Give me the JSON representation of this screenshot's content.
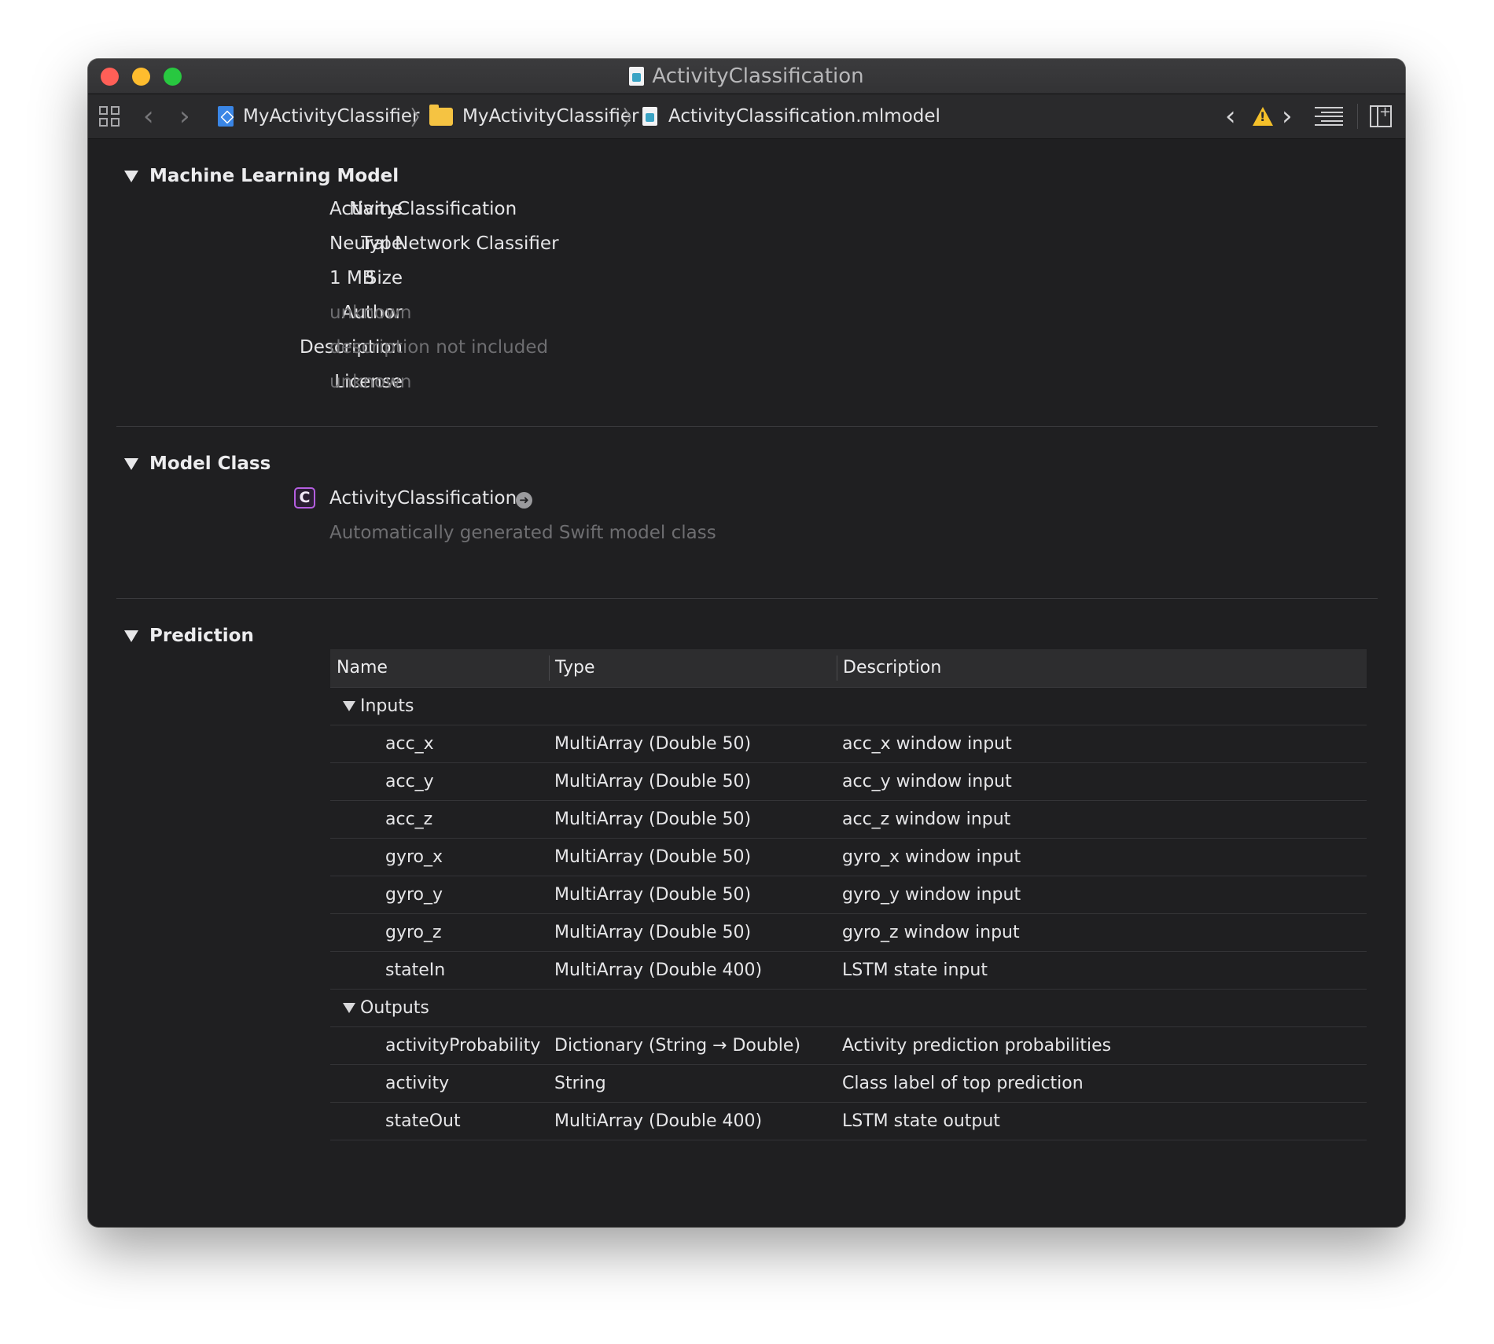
{
  "window": {
    "title": "ActivityClassification",
    "colors": {
      "close": "#ff5f57",
      "minimize": "#febc2e",
      "zoom": "#28c840",
      "background": "#1f1f21",
      "class_badge": "#b45ee0",
      "warning": "#f4c02a"
    }
  },
  "jumpbar": {
    "crumbs": [
      {
        "label": "MyActivityClassifier",
        "icon": "xcode-project-icon"
      },
      {
        "label": "MyActivityClassifier",
        "icon": "folder-icon"
      },
      {
        "label": "ActivityClassification.mlmodel",
        "icon": "mlmodel-file-icon"
      }
    ]
  },
  "model": {
    "section_title": "Machine Learning Model",
    "fields": [
      {
        "label": "Name",
        "value": "ActivityClassification"
      },
      {
        "label": "Type",
        "value": "Neural Network Classifier"
      },
      {
        "label": "Size",
        "value": "1 MB"
      },
      {
        "label": "Author",
        "value": "unknown"
      },
      {
        "label": "Description",
        "value": "description not included"
      },
      {
        "label": "License",
        "value": "unknown"
      }
    ]
  },
  "model_class": {
    "section_title": "Model Class",
    "badge": "C",
    "name": "ActivityClassification",
    "subtitle": "Automatically generated Swift model class"
  },
  "prediction": {
    "section_title": "Prediction",
    "columns": [
      "Name",
      "Type",
      "Description"
    ],
    "inputs_label": "Inputs",
    "inputs": [
      {
        "name": "acc_x",
        "type": "MultiArray (Double 50)",
        "description": "acc_x window input"
      },
      {
        "name": "acc_y",
        "type": "MultiArray (Double 50)",
        "description": "acc_y window input"
      },
      {
        "name": "acc_z",
        "type": "MultiArray (Double 50)",
        "description": "acc_z window input"
      },
      {
        "name": "gyro_x",
        "type": "MultiArray (Double 50)",
        "description": "gyro_x window input"
      },
      {
        "name": "gyro_y",
        "type": "MultiArray (Double 50)",
        "description": "gyro_y window input"
      },
      {
        "name": "gyro_z",
        "type": "MultiArray (Double 50)",
        "description": "gyro_z window input"
      },
      {
        "name": "stateIn",
        "type": "MultiArray (Double 400)",
        "description": "LSTM state input"
      }
    ],
    "outputs_label": "Outputs",
    "outputs": [
      {
        "name": "activityProbability",
        "type": "Dictionary (String → Double)",
        "description": "Activity prediction probabilities"
      },
      {
        "name": "activity",
        "type": "String",
        "description": "Class label of top prediction"
      },
      {
        "name": "stateOut",
        "type": "MultiArray (Double 400)",
        "description": "LSTM state output"
      }
    ]
  }
}
